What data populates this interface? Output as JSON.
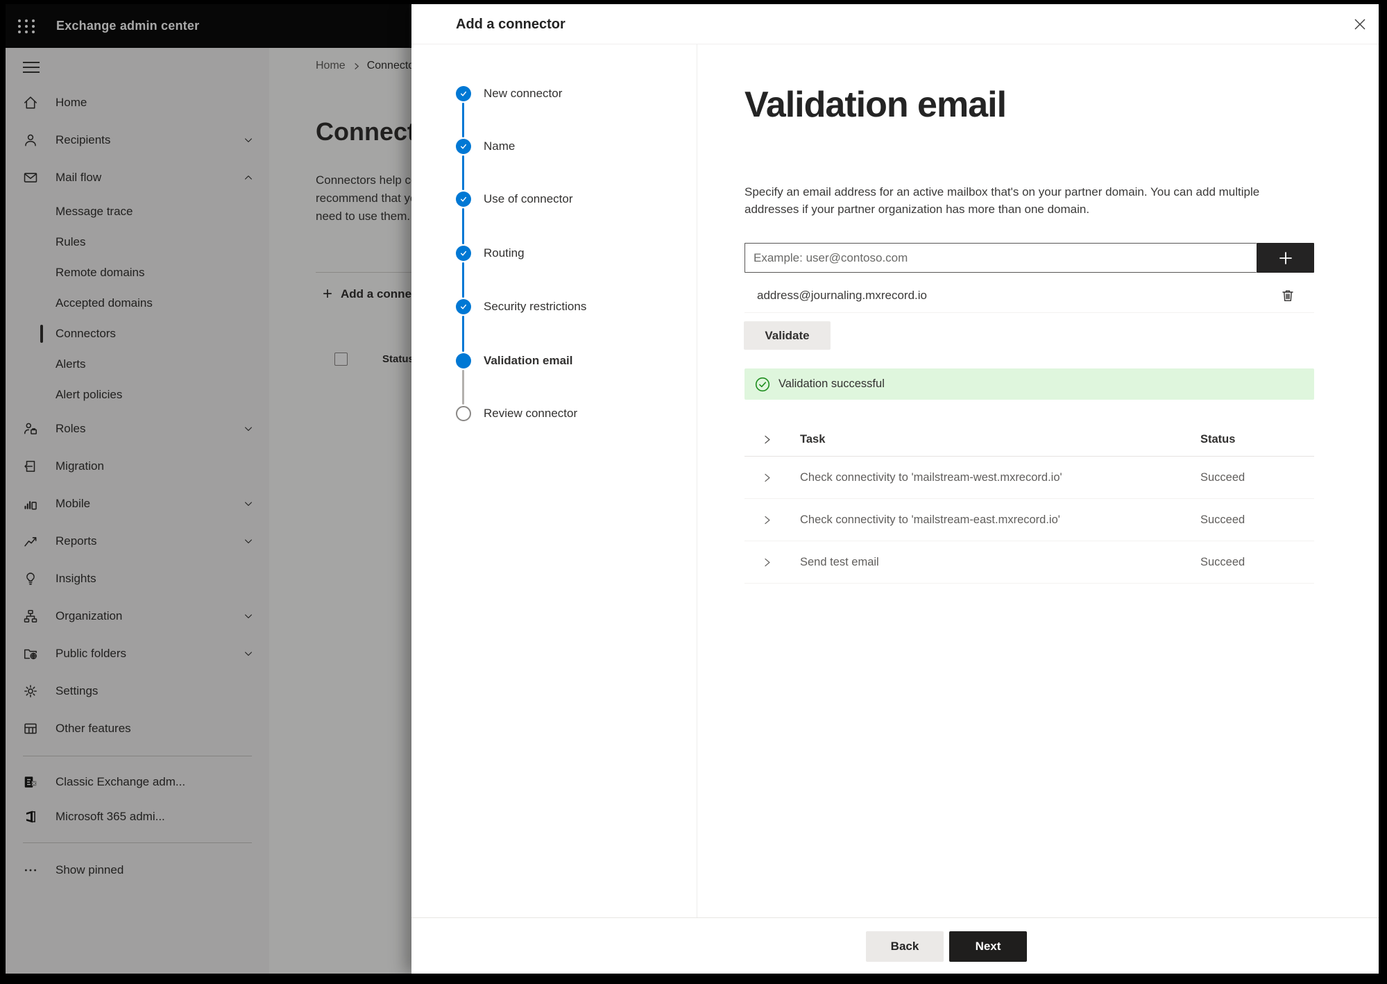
{
  "topbar": {
    "app_title": "Exchange admin center"
  },
  "sidebar": {
    "items": [
      {
        "label": "Home"
      },
      {
        "label": "Recipients"
      },
      {
        "label": "Mail flow"
      },
      {
        "label": "Message trace"
      },
      {
        "label": "Rules"
      },
      {
        "label": "Remote domains"
      },
      {
        "label": "Accepted domains"
      },
      {
        "label": "Connectors"
      },
      {
        "label": "Alerts"
      },
      {
        "label": "Alert policies"
      },
      {
        "label": "Roles"
      },
      {
        "label": "Migration"
      },
      {
        "label": "Mobile"
      },
      {
        "label": "Reports"
      },
      {
        "label": "Insights"
      },
      {
        "label": "Organization"
      },
      {
        "label": "Public folders"
      },
      {
        "label": "Settings"
      },
      {
        "label": "Other features"
      },
      {
        "label": "Classic Exchange adm..."
      },
      {
        "label": "Microsoft 365 admi..."
      },
      {
        "label": "Show pinned"
      }
    ]
  },
  "page": {
    "breadcrumb": {
      "home": "Home",
      "current": "Connectors"
    },
    "title": "Connectors",
    "intro_lines": [
      "Connectors help control the flow of email messages to",
      "recommend that you first check to see if you",
      "need to use them. Learn more"
    ],
    "add_button": "Add a connector",
    "list_header_status": "Status"
  },
  "dialog": {
    "title": "Add a connector",
    "steps": [
      {
        "label": "New connector",
        "state": "done"
      },
      {
        "label": "Name",
        "state": "done"
      },
      {
        "label": "Use of connector",
        "state": "done"
      },
      {
        "label": "Routing",
        "state": "done"
      },
      {
        "label": "Security restrictions",
        "state": "done"
      },
      {
        "label": "Validation email",
        "state": "active"
      },
      {
        "label": "Review connector",
        "state": "todo"
      }
    ],
    "content": {
      "title": "Validation email",
      "description": "Specify an email address for an active mailbox that's on your partner domain. You can add multiple addresses if your partner organization has more than one domain.",
      "email_placeholder": "Example: user@contoso.com",
      "added_address": "address@journaling.mxrecord.io",
      "validate_button": "Validate",
      "success_message": "Validation successful",
      "table": {
        "headers": {
          "task": "Task",
          "status": "Status"
        },
        "rows": [
          {
            "task": "Check connectivity to 'mailstream-west.mxrecord.io'",
            "status": "Succeed"
          },
          {
            "task": "Check connectivity to 'mailstream-east.mxrecord.io'",
            "status": "Succeed"
          },
          {
            "task": "Send test email",
            "status": "Succeed"
          }
        ]
      }
    },
    "footer": {
      "back": "Back",
      "next": "Next"
    }
  },
  "colors": {
    "accent": "#0078d4",
    "success_bg": "#dff6dd",
    "success_green": "#1e8e1e"
  }
}
